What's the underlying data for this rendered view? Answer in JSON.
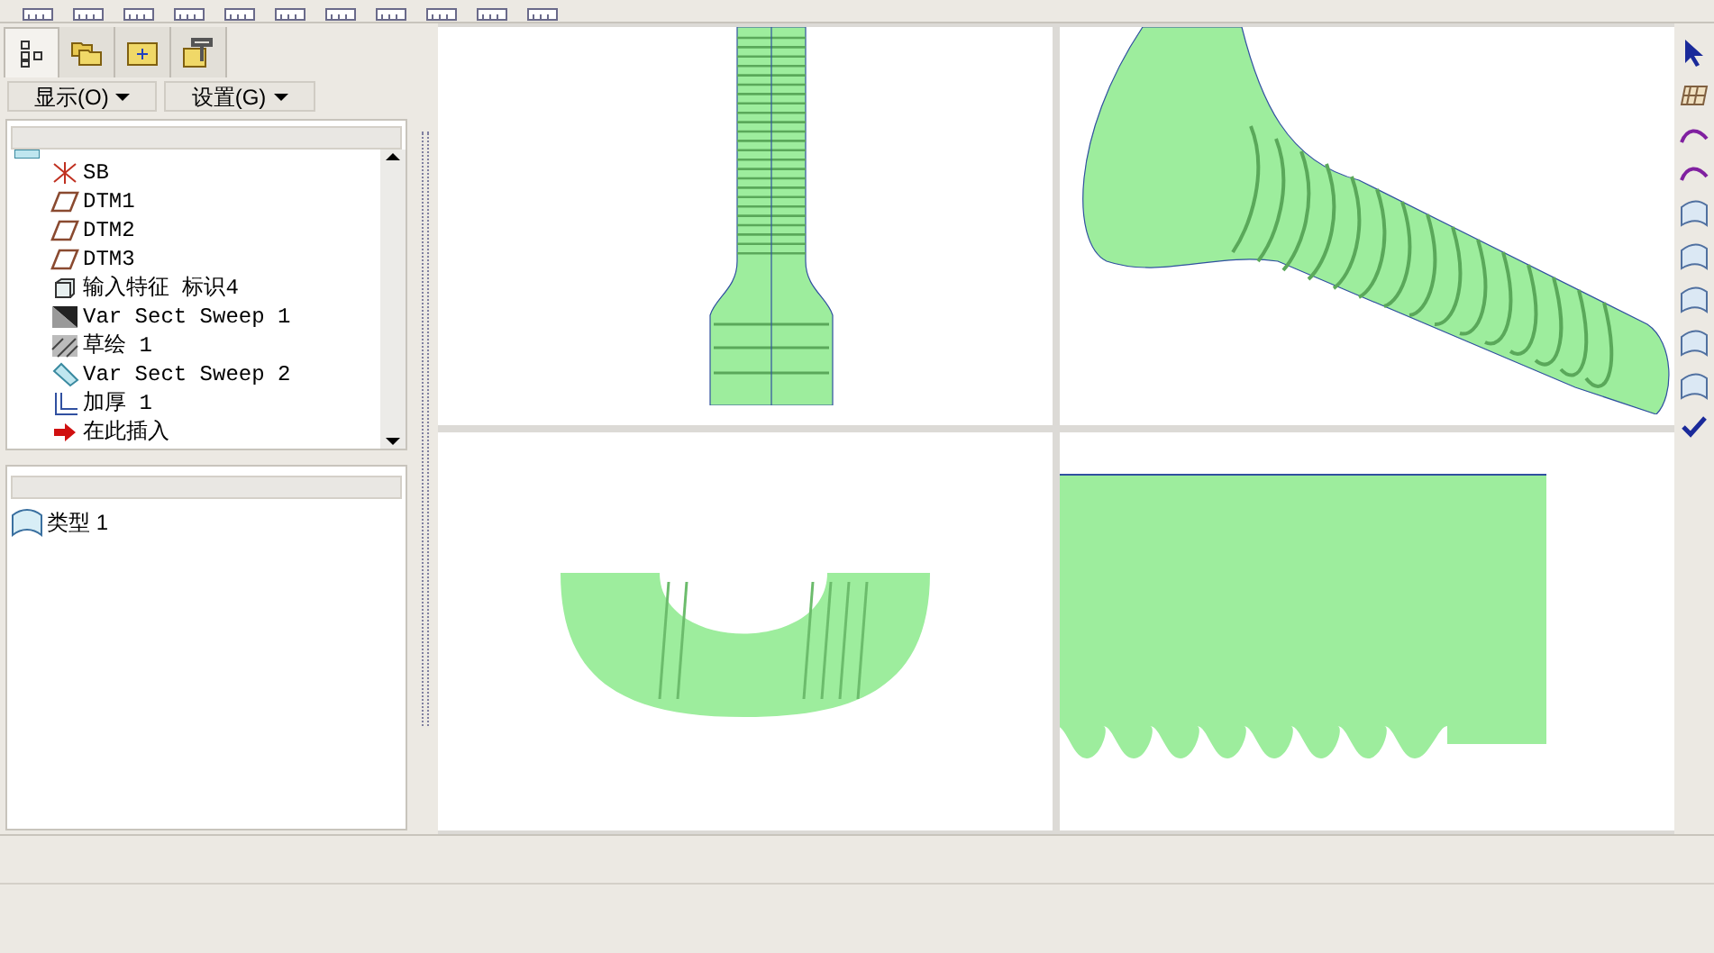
{
  "nav_tabs": [
    {
      "kind": "tree",
      "selected": true
    },
    {
      "kind": "folders",
      "selected": false
    },
    {
      "kind": "favorites",
      "selected": false
    },
    {
      "kind": "tools",
      "selected": false
    }
  ],
  "menus": [
    "显示(O)",
    "设置(G)"
  ],
  "model_tree": {
    "items": [
      {
        "label": "SB",
        "kind": "csys"
      },
      {
        "label": "DTM1",
        "kind": "plane"
      },
      {
        "label": "DTM2",
        "kind": "plane"
      },
      {
        "label": "DTM3",
        "kind": "plane"
      },
      {
        "label": "输入特征 标识4",
        "kind": "import"
      },
      {
        "label": "Var Sect Sweep 1",
        "kind": "sweep"
      },
      {
        "label": "草绘 1",
        "kind": "sketch"
      },
      {
        "label": "Var Sect Sweep 2",
        "kind": "sweep2"
      },
      {
        "label": "加厚 1",
        "kind": "thicken"
      },
      {
        "label": "在此插入",
        "kind": "insert"
      }
    ]
  },
  "layers": {
    "items": [
      {
        "label": "类型 1"
      }
    ]
  },
  "viewports": [
    {
      "kind": "front"
    },
    {
      "kind": "iso"
    },
    {
      "kind": "bottom"
    },
    {
      "kind": "side"
    }
  ]
}
